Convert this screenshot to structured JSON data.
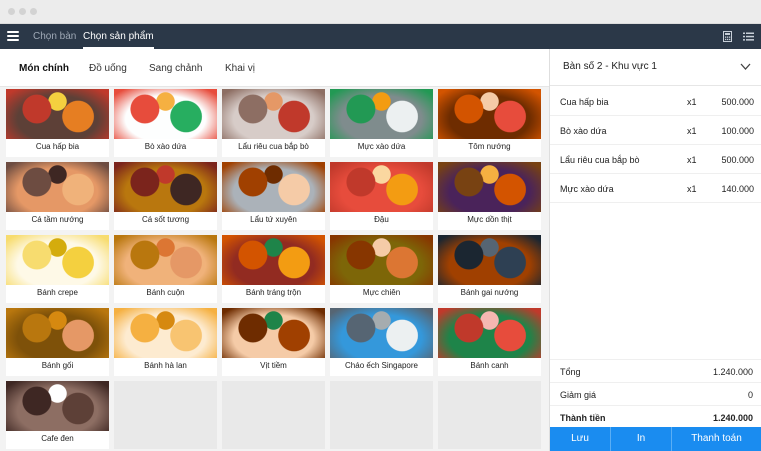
{
  "nav": {
    "tabs": [
      {
        "label": "Chọn bàn",
        "active": false
      },
      {
        "label": "Chọn sản phẩm",
        "active": true
      }
    ],
    "icons": [
      "menu-icon",
      "calculator-icon",
      "list-icon"
    ]
  },
  "categories": [
    {
      "label": "Món chính",
      "active": true
    },
    {
      "label": "Đồ uống",
      "active": false
    },
    {
      "label": "Sang chảnh",
      "active": false
    },
    {
      "label": "Khai vị",
      "active": false
    }
  ],
  "products": [
    {
      "name": "Cua hấp bia"
    },
    {
      "name": "Bò xào dứa"
    },
    {
      "name": "Lẩu riêu cua bắp bò"
    },
    {
      "name": "Mực xào dứa"
    },
    {
      "name": "Tôm nướng"
    },
    {
      "name": "Cá tầm nướng"
    },
    {
      "name": "Cá sốt tương"
    },
    {
      "name": "Lẩu tứ xuyên"
    },
    {
      "name": "Đậu"
    },
    {
      "name": "Mực dồn thịt"
    },
    {
      "name": "Bánh crepe"
    },
    {
      "name": "Bánh cuộn"
    },
    {
      "name": "Bánh tráng trộn"
    },
    {
      "name": "Mực chiên"
    },
    {
      "name": "Bánh gai nướng"
    },
    {
      "name": "Bánh gối"
    },
    {
      "name": "Bánh hà lan"
    },
    {
      "name": "Vịt tiềm"
    },
    {
      "name": "Cháo ếch Singapore"
    },
    {
      "name": "Bánh canh"
    },
    {
      "name": "Cafe đen"
    }
  ],
  "order": {
    "table_label": "Bàn số 2 - Khu vực 1",
    "items": [
      {
        "name": "Cua hấp bia",
        "qty": "x1",
        "price": "500.000"
      },
      {
        "name": "Bò xào dứa",
        "qty": "x1",
        "price": "100.000"
      },
      {
        "name": "Lẩu riêu cua bắp bò",
        "qty": "x1",
        "price": "500.000"
      },
      {
        "name": "Mực xào dứa",
        "qty": "x1",
        "price": "140.000"
      }
    ],
    "summary": {
      "total_label": "Tổng",
      "total": "1.240.000",
      "discount_label": "Giảm giá",
      "discount": "0",
      "grand_label": "Thành tiền",
      "grand": "1.240.000"
    },
    "buttons": {
      "save": "Lưu",
      "print": "In",
      "pay": "Thanh toán"
    }
  },
  "colors": {
    "navbar": "#2b3848",
    "accent": "#1a8cf0"
  }
}
